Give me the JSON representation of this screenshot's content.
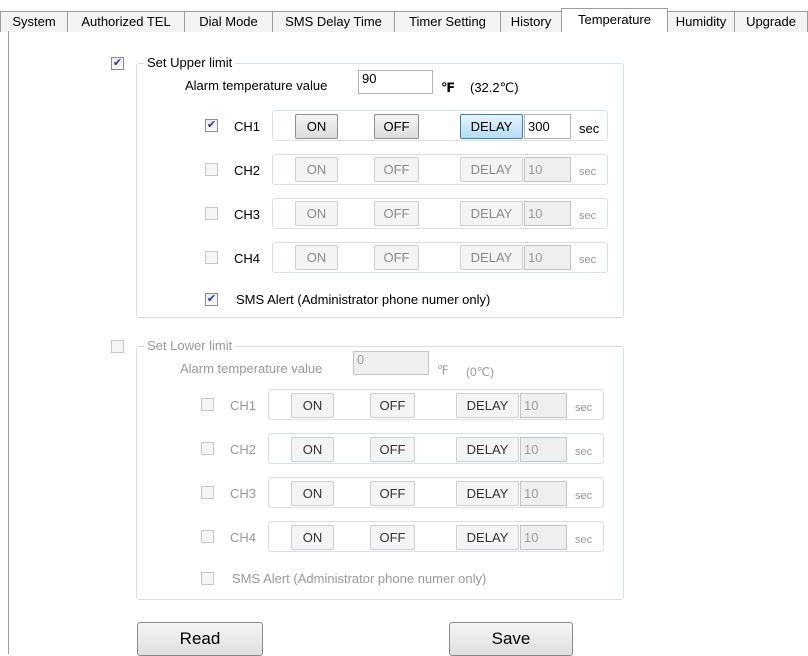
{
  "tabs": [
    {
      "label": "System"
    },
    {
      "label": "Authorized TEL"
    },
    {
      "label": "Dial Mode"
    },
    {
      "label": "SMS Delay Time"
    },
    {
      "label": "Timer Setting"
    },
    {
      "label": "History"
    },
    {
      "label": "Temperature",
      "active": true
    },
    {
      "label": "Humidity"
    },
    {
      "label": "Upgrade"
    }
  ],
  "upper": {
    "enabled": true,
    "legend": "Set Upper limit",
    "alarm_label": "Alarm temperature value",
    "alarm_value": "90",
    "unit": "℉",
    "converted": "(32.2℃)",
    "channels": [
      {
        "name": "CH1",
        "checked": true,
        "on": "ON",
        "off": "OFF",
        "delay": "DELAY",
        "delay_value": "300",
        "sec": "sec"
      },
      {
        "name": "CH2",
        "checked": false,
        "on": "ON",
        "off": "OFF",
        "delay": "DELAY",
        "delay_value": "10",
        "sec": "sec"
      },
      {
        "name": "CH3",
        "checked": false,
        "on": "ON",
        "off": "OFF",
        "delay": "DELAY",
        "delay_value": "10",
        "sec": "sec"
      },
      {
        "name": "CH4",
        "checked": false,
        "on": "ON",
        "off": "OFF",
        "delay": "DELAY",
        "delay_value": "10",
        "sec": "sec"
      }
    ],
    "sms_label": "SMS Alert (Administrator phone numer only)",
    "sms_checked": true
  },
  "lower": {
    "enabled": false,
    "legend": "Set Lower limit",
    "alarm_label": "Alarm temperature value",
    "alarm_value": "0",
    "unit": "℉",
    "converted": "(0℃)",
    "channels": [
      {
        "name": "CH1",
        "checked": false,
        "on": "ON",
        "off": "OFF",
        "delay": "DELAY",
        "delay_value": "10",
        "sec": "sec"
      },
      {
        "name": "CH2",
        "checked": false,
        "on": "ON",
        "off": "OFF",
        "delay": "DELAY",
        "delay_value": "10",
        "sec": "sec"
      },
      {
        "name": "CH3",
        "checked": false,
        "on": "ON",
        "off": "OFF",
        "delay": "DELAY",
        "delay_value": "10",
        "sec": "sec"
      },
      {
        "name": "CH4",
        "checked": false,
        "on": "ON",
        "off": "OFF",
        "delay": "DELAY",
        "delay_value": "10",
        "sec": "sec"
      }
    ],
    "sms_label": "SMS Alert (Administrator phone numer only)",
    "sms_checked": false
  },
  "actions": {
    "read_label": "Read",
    "save_label": "Save"
  },
  "check_glyph": "✔"
}
